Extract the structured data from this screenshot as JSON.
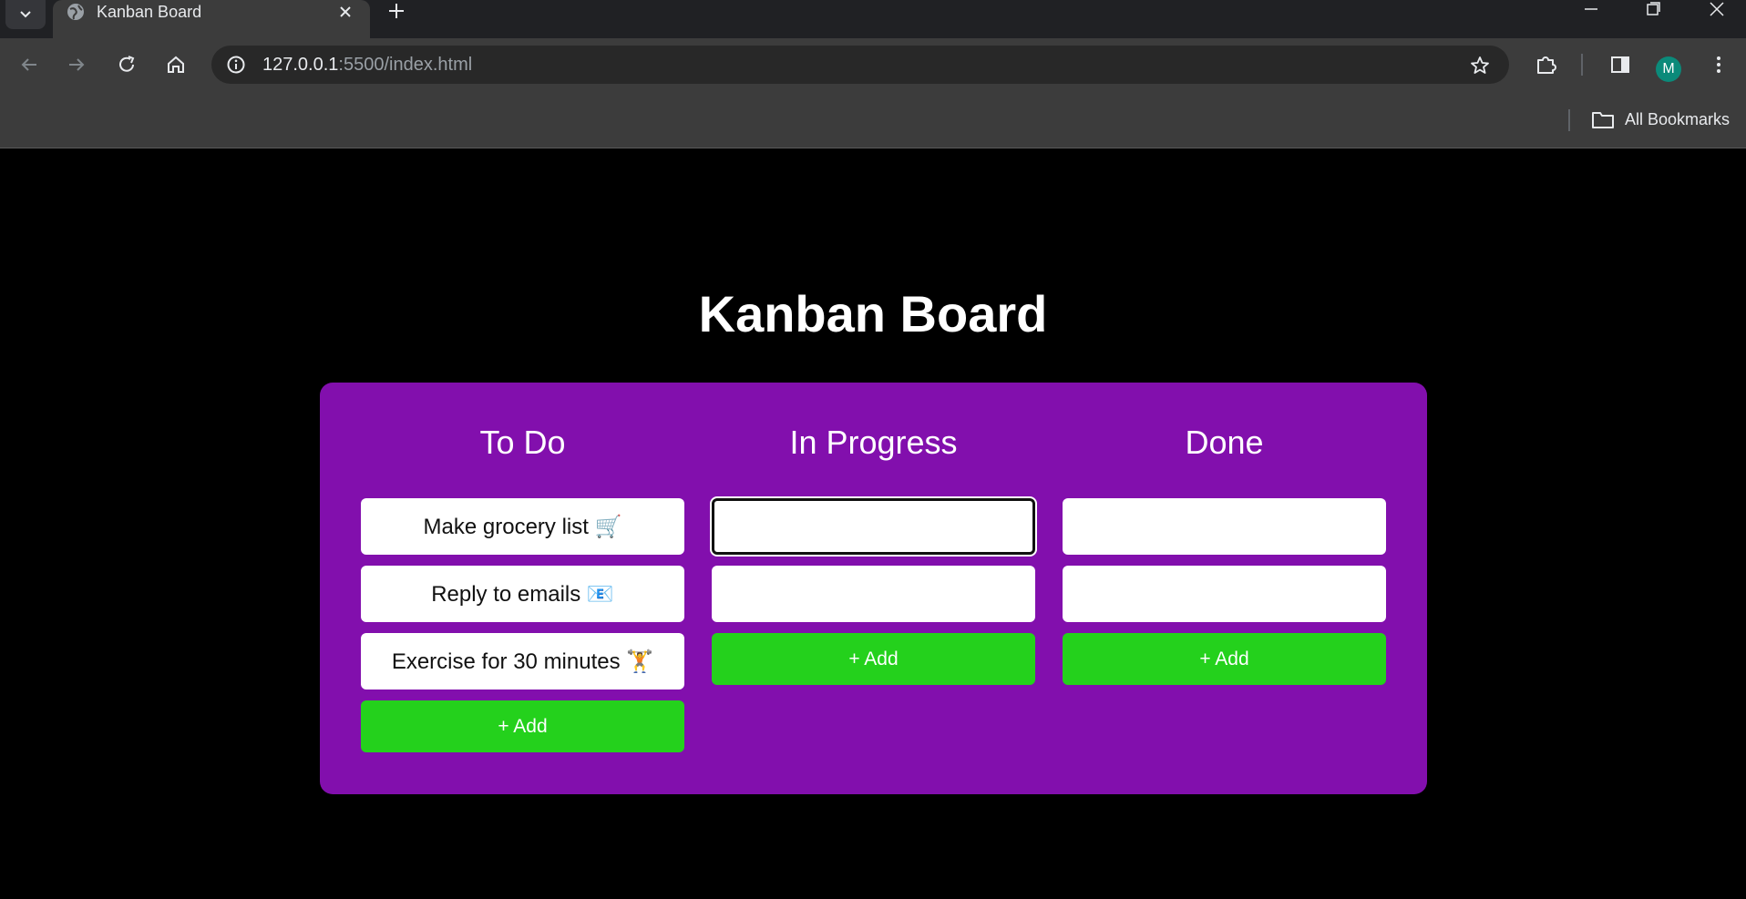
{
  "browser": {
    "tab_title": "Kanban Board",
    "url_host": "127.0.0.1",
    "url_rest": ":5500/index.html",
    "profile_initial": "M",
    "bookmarks_label": "All Bookmarks"
  },
  "page": {
    "title": "Kanban Board"
  },
  "columns": [
    {
      "title": "To Do",
      "cards": [
        "Make grocery list 🛒",
        "Reply to emails 📧",
        "Exercise for 30 minutes 🏋️"
      ],
      "add_label": "+ Add"
    },
    {
      "title": "In Progress",
      "cards": [
        "",
        ""
      ],
      "add_label": "+ Add"
    },
    {
      "title": "Done",
      "cards": [
        "",
        ""
      ],
      "add_label": "+ Add"
    }
  ],
  "colors": {
    "page_background": "#000000",
    "board_background": "#820fad",
    "add_button": "#24d11c",
    "card_background": "#ffffff"
  }
}
